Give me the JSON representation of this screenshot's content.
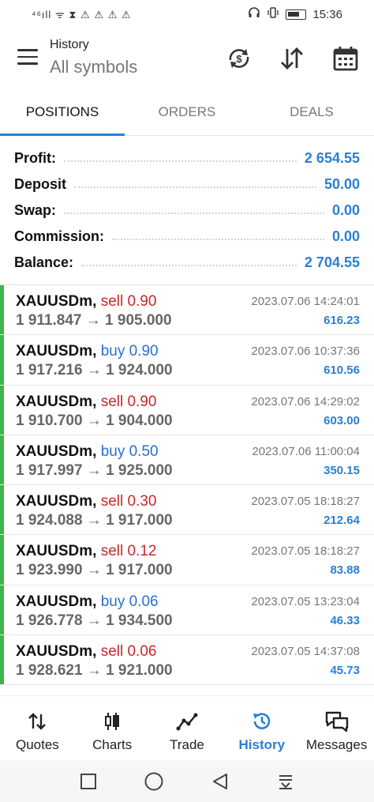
{
  "status_bar": {
    "left_text": "⁴⁶ıll ᯤ ⧗ ⚠ ⚠ ⚠ ⚠",
    "right_icons": "🎧 ▯",
    "time": "15:36"
  },
  "header": {
    "subtitle": "History",
    "title": "All symbols",
    "icons": [
      "sync-currency-icon",
      "sort-icon",
      "calendar-icon"
    ]
  },
  "tabs": [
    {
      "label": "POSITIONS",
      "active": true
    },
    {
      "label": "ORDERS",
      "active": false
    },
    {
      "label": "DEALS",
      "active": false
    }
  ],
  "summary": [
    {
      "label": "Profit:",
      "value": "2 654.55"
    },
    {
      "label": "Deposit",
      "value": "50.00"
    },
    {
      "label": "Swap:",
      "value": "0.00"
    },
    {
      "label": "Commission:",
      "value": "0.00"
    },
    {
      "label": "Balance:",
      "value": "2 704.55"
    }
  ],
  "deals": [
    {
      "symbol": "XAUUSDm,",
      "side": "sell",
      "volume": "sell 0.90",
      "prices": "1 911.847 → 1 905.000",
      "time": "2023.07.06 14:24:01",
      "profit": "616.23"
    },
    {
      "symbol": "XAUUSDm,",
      "side": "buy",
      "volume": "buy 0.90",
      "prices": "1 917.216 → 1 924.000",
      "time": "2023.07.06 10:37:36",
      "profit": "610.56"
    },
    {
      "symbol": "XAUUSDm,",
      "side": "sell",
      "volume": "sell 0.90",
      "prices": "1 910.700 → 1 904.000",
      "time": "2023.07.06 14:29:02",
      "profit": "603.00"
    },
    {
      "symbol": "XAUUSDm,",
      "side": "buy",
      "volume": "buy 0.50",
      "prices": "1 917.997 → 1 925.000",
      "time": "2023.07.06 11:00:04",
      "profit": "350.15"
    },
    {
      "symbol": "XAUUSDm,",
      "side": "sell",
      "volume": "sell 0.30",
      "prices": "1 924.088 → 1 917.000",
      "time": "2023.07.05 18:18:27",
      "profit": "212.64"
    },
    {
      "symbol": "XAUUSDm,",
      "side": "sell",
      "volume": "sell 0.12",
      "prices": "1 923.990 → 1 917.000",
      "time": "2023.07.05 18:18:27",
      "profit": "83.88"
    },
    {
      "symbol": "XAUUSDm,",
      "side": "buy",
      "volume": "buy 0.06",
      "prices": "1 926.778 → 1 934.500",
      "time": "2023.07.05 13:23:04",
      "profit": "46.33"
    },
    {
      "symbol": "XAUUSDm,",
      "side": "sell",
      "volume": "sell 0.06",
      "prices": "1 928.621 → 1 921.000",
      "time": "2023.07.05 14:37:08",
      "profit": "45.73"
    }
  ],
  "bottom_nav": [
    {
      "label": "Quotes",
      "icon": "quotes-icon",
      "active": false
    },
    {
      "label": "Charts",
      "icon": "charts-icon",
      "active": false
    },
    {
      "label": "Trade",
      "icon": "trade-icon",
      "active": false
    },
    {
      "label": "History",
      "icon": "history-icon",
      "active": true
    },
    {
      "label": "Messages",
      "icon": "messages-icon",
      "active": false
    }
  ],
  "colors": {
    "accent": "#2a7fd4",
    "sell": "#c62828",
    "buy": "#2a6fd4",
    "profit_bar": "#3cb54a"
  }
}
